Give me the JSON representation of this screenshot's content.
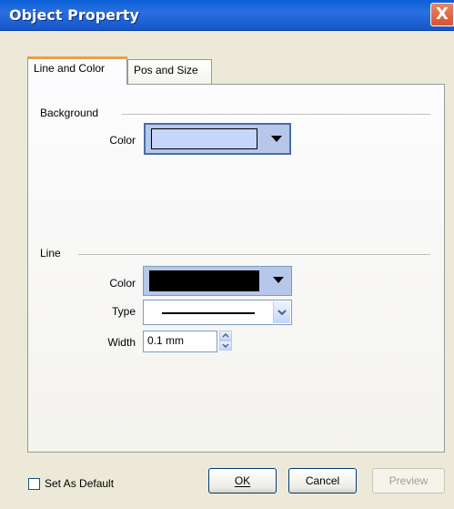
{
  "window": {
    "title": "Object Property",
    "close_glyph": "X"
  },
  "tabs": [
    {
      "label": "Line and Color",
      "active": true
    },
    {
      "label": "Pos and Size",
      "active": false
    }
  ],
  "background_group": {
    "title": "Background",
    "color_label": "Color",
    "color_value": "#c6d6fb"
  },
  "line_group": {
    "title": "Line",
    "color_label": "Color",
    "color_value": "#000000",
    "type_label": "Type",
    "width_label": "Width",
    "width_value": "0.1 mm"
  },
  "footer": {
    "set_default_label": "Set As Default",
    "set_default_checked": false,
    "ok_label": "OK",
    "cancel_label": "Cancel",
    "preview_label": "Preview"
  },
  "icons": {
    "close": "close-icon",
    "dropdown": "chevron-down-icon",
    "spin_up": "arrow-up-icon",
    "spin_down": "arrow-down-icon"
  }
}
